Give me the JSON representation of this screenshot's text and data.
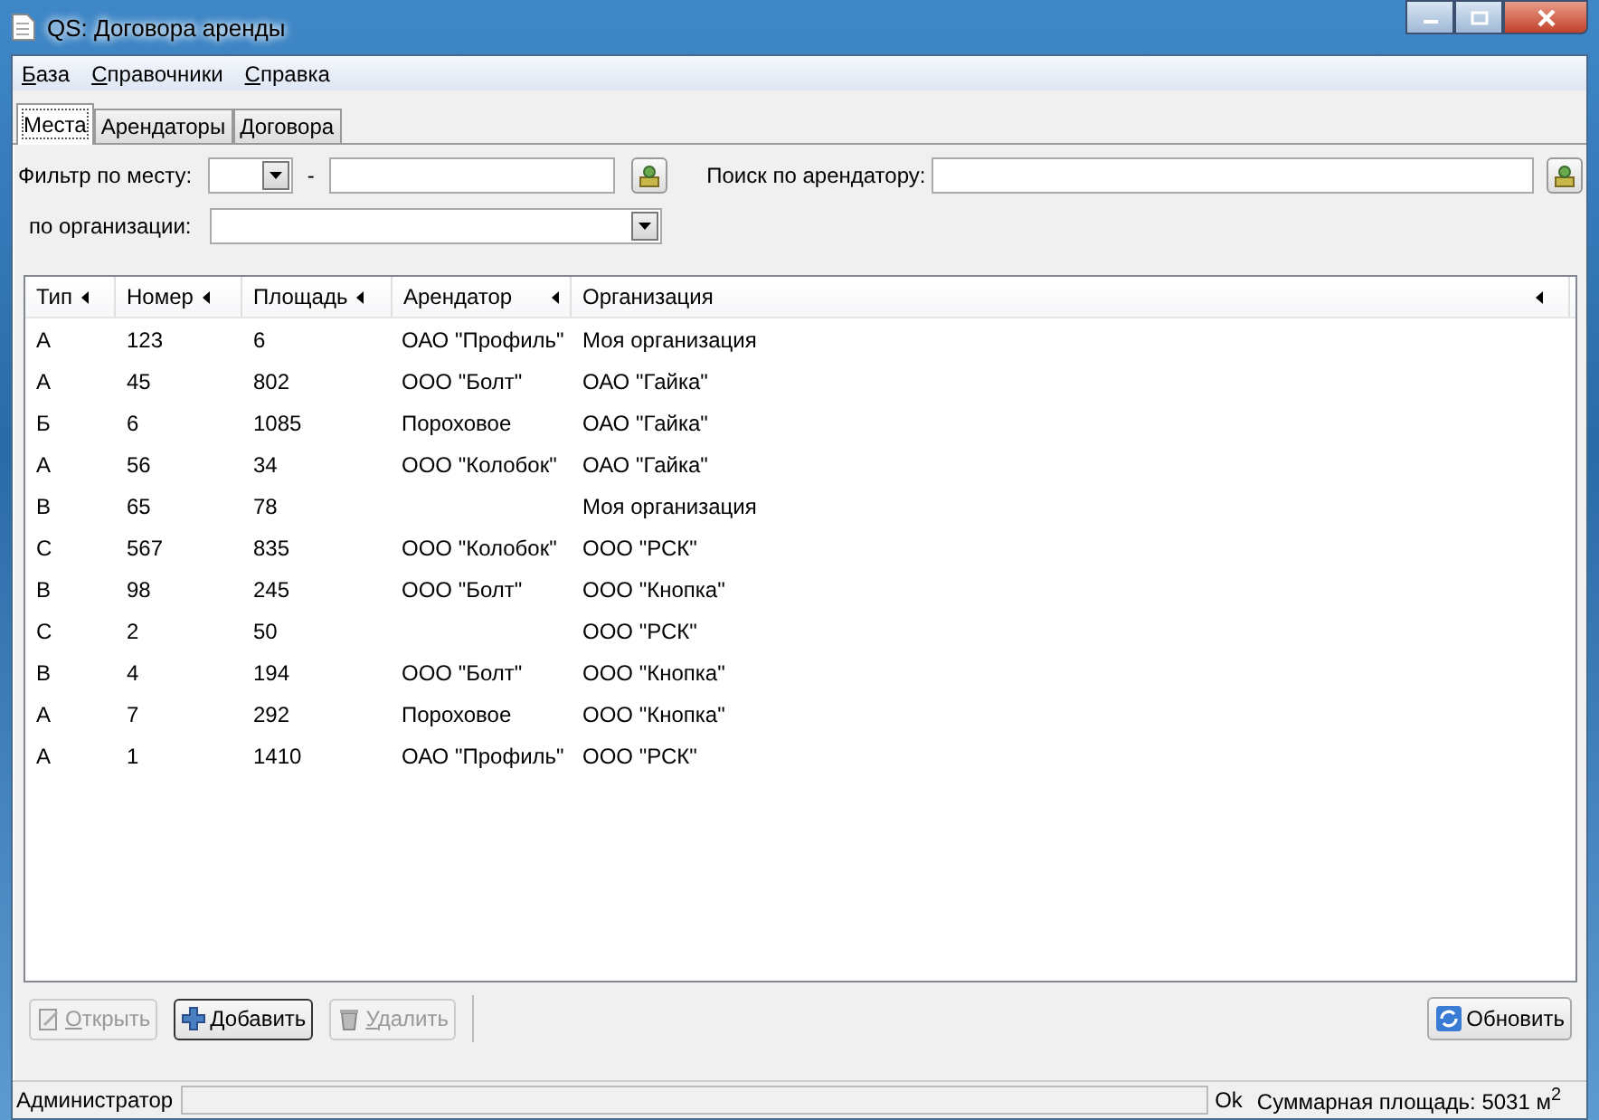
{
  "window": {
    "title": "QS: Договора аренды"
  },
  "menu": [
    "База",
    "Справочники",
    "Справка"
  ],
  "tabs": [
    {
      "label": "Места",
      "selected": true
    },
    {
      "label": "Арендаторы",
      "selected": false
    },
    {
      "label": "Договора",
      "selected": false
    }
  ],
  "filters": {
    "place_label": "Фильтр по месту:",
    "dash": "-",
    "search_label": "Поиск по арендатору:",
    "org_label": "по организации:"
  },
  "table": {
    "columns": [
      "Тип",
      "Номер",
      "Площадь",
      "Арендатор",
      "Организация"
    ],
    "rows": [
      [
        "А",
        "123",
        "6",
        "ОАО \"Профиль\"",
        "Моя организация"
      ],
      [
        "А",
        "45",
        "802",
        "ООО \"Болт\"",
        "ОАО \"Гайка\""
      ],
      [
        "Б",
        "6",
        "1085",
        "Пороховое",
        "ОАО \"Гайка\""
      ],
      [
        "А",
        "56",
        "34",
        "ООО \"Колобок\"",
        "ОАО \"Гайка\""
      ],
      [
        "В",
        "65",
        "78",
        "",
        "Моя организация"
      ],
      [
        "С",
        "567",
        "835",
        "ООО \"Колобок\"",
        "ООО \"РСК\""
      ],
      [
        "В",
        "98",
        "245",
        "ООО \"Болт\"",
        "ООО \"Кнопка\""
      ],
      [
        "С",
        "2",
        "50",
        "",
        "ООО \"РСК\""
      ],
      [
        "В",
        "4",
        "194",
        "ООО \"Болт\"",
        "ООО \"Кнопка\""
      ],
      [
        "А",
        "7",
        "292",
        "Пороховое",
        "ООО \"Кнопка\""
      ],
      [
        "А",
        "1",
        "1410",
        "ОАО \"Профиль\"",
        "ООО \"РСК\""
      ]
    ]
  },
  "buttons": [
    {
      "label": "Открыть",
      "kind": "open",
      "disabled": true
    },
    {
      "label": "Добавить",
      "kind": "add",
      "disabled": false
    },
    {
      "label": "Удалить",
      "kind": "delete",
      "disabled": true
    }
  ],
  "refresh_button": {
    "label": "Обновить"
  },
  "status_bar": {
    "user": "Администратор",
    "state": "Ok",
    "total": "Суммарная площадь: 5031 м$^{2}$"
  }
}
